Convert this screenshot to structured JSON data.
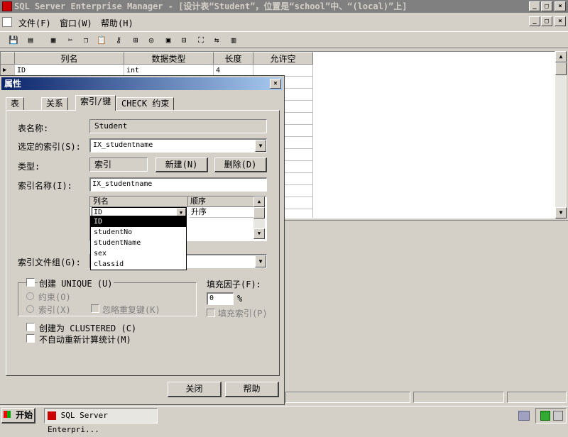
{
  "window": {
    "title": "SQL Server Enterprise Manager - [设计表“Student”，位置是“school”中、“(local)”上]",
    "controls": [
      "_",
      "□",
      "×"
    ]
  },
  "menu": {
    "file": "文件(F)",
    "window": "窗口(W)",
    "help": "帮助(H)"
  },
  "grid": {
    "headers": [
      "列名",
      "数据类型",
      "长度",
      "允许空"
    ],
    "row": {
      "name": "ID",
      "type": "int",
      "length": "4"
    }
  },
  "dialog": {
    "title": "属性",
    "tabs": [
      "表",
      "关系",
      "索引/键",
      "CHECK 约束"
    ],
    "table_name_label": "表名称:",
    "table_name_value": "Student",
    "selected_index_label": "选定的索引(S):",
    "selected_index_value": "IX_studentname",
    "type_label": "类型:",
    "type_value": "索引",
    "new_button": "新建(N)",
    "delete_button": "删除(D)",
    "index_name_label": "索引名称(I):",
    "index_name_value": "IX_studentname",
    "col_header_name": "列名",
    "col_header_order": "顺序",
    "col_row_name": "ID",
    "col_row_order": "升序",
    "dropdown_options": [
      "ID",
      "studentNo",
      "studentName",
      "sex",
      "classid"
    ],
    "filegroup_label": "索引文件组(G):",
    "create_unique_label": "创建 UNIQUE (U)",
    "constraint_label": "约束(O)",
    "index_label": "索引(X)",
    "ignore_dup_label": "忽略重复键(K)",
    "fill_factor_label": "填充因子(F):",
    "fill_factor_value": "0",
    "percent": "%",
    "pad_index_label": "填充索引(P)",
    "clustered_label": "创建为 CLUSTERED (C)",
    "no_recompute_label": "不自动重新计算统计(M)",
    "close_button": "关闭",
    "help_button": "帮助"
  },
  "taskbar": {
    "start": "开始",
    "task": "SQL Server Enterpri..."
  }
}
